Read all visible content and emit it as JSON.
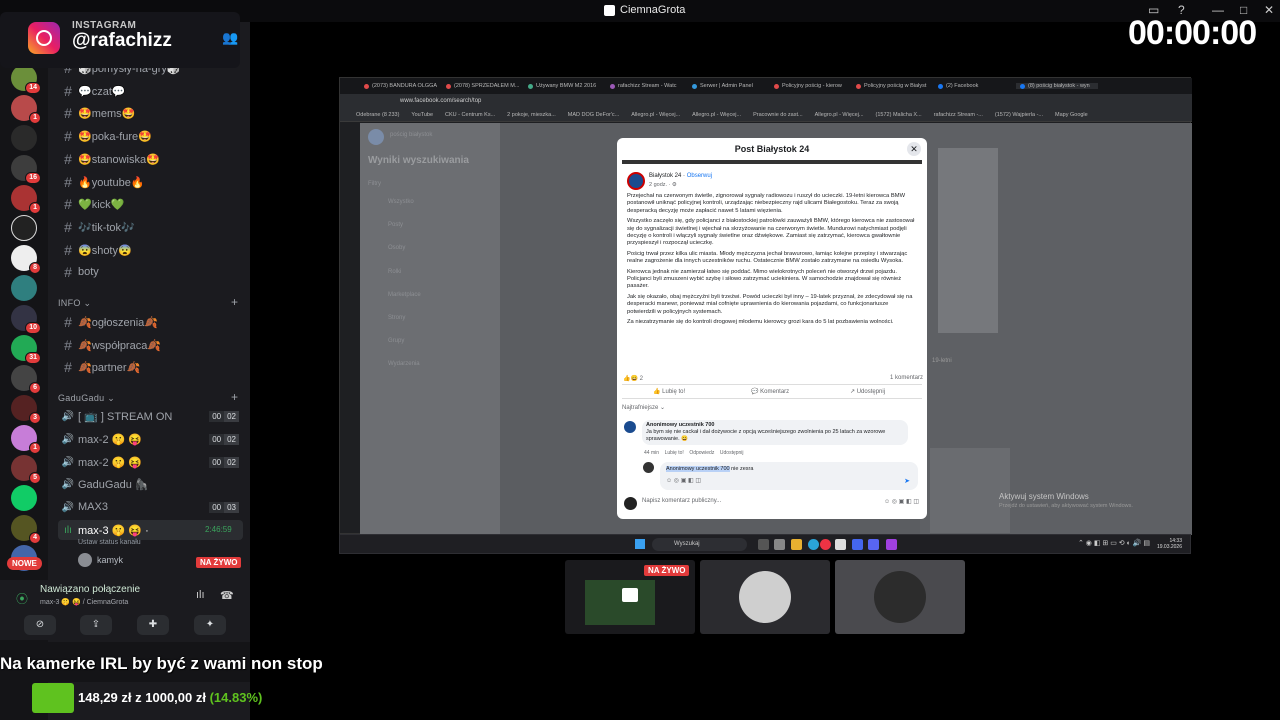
{
  "window": {
    "title": "CiemnaGrota"
  },
  "instagram": {
    "label": "INSTAGRAM",
    "handle": "@rafachizz"
  },
  "stream_timer": "00:00:00",
  "server_badges": [
    "14",
    "1",
    "16",
    "1",
    "8",
    "10",
    "31",
    "6",
    "3",
    "1",
    "5",
    "4"
  ],
  "channels": [
    {
      "label": "🎲pomysły-na-gry🎲"
    },
    {
      "label": "💬czat💬"
    },
    {
      "label": "🤩mems🤩"
    },
    {
      "label": "🤩poka-fure🤩"
    },
    {
      "label": "🤩stanowiska🤩"
    },
    {
      "label": "🔥youtube🔥"
    },
    {
      "label": "💚kick💚"
    },
    {
      "label": "🎶tik-tok🎶"
    },
    {
      "label": "😨shoty😨"
    },
    {
      "label": "boty"
    }
  ],
  "info_category": "INFO",
  "info_channels": [
    {
      "label": "🍂ogłoszenia🍂"
    },
    {
      "label": "🍂współpraca🍂"
    },
    {
      "label": "🍂partner🍂"
    }
  ],
  "voice_category": "GaduGadu",
  "voice_channels": [
    {
      "label": "[ 📺 ] STREAM ON",
      "count": "00",
      "limit": "02"
    },
    {
      "label": "max-2 🤫 😝",
      "count": "00",
      "limit": "02"
    },
    {
      "label": "max-2 🤫 😝",
      "count": "00",
      "limit": "02"
    },
    {
      "label": "GaduGadu 🦍",
      "count": "",
      "limit": ""
    },
    {
      "label": "MAX3",
      "count": "00",
      "limit": "03"
    },
    {
      "label": "max-3 🤫 😝 ·",
      "count": "",
      "limit": ""
    }
  ],
  "active_voice": {
    "timer": "2:46:59",
    "status_hint": "Ustaw status kanału",
    "user": "kamyk",
    "live_badge": "NA ŻYWO",
    "new_badge": "NOWE"
  },
  "voice_panel": {
    "title": "Nawiązano połączenie",
    "subtitle": "max-3 🤫 😝 / CiemnaGrota"
  },
  "browser": {
    "tabs": [
      "(2073) BANDURA OLGGA",
      "(2078) SPRZEDAŁEM M...",
      "Używany BMW M2 2016",
      "rafachizz Stream - Watc",
      "Serwer | Admin Panel",
      "Policyjny pościg - kierow",
      "Policyjny pościg w Białyst",
      "(2) Facebook",
      "(8) pościg białystok - wyn"
    ],
    "address": "www.facebook.com/search/top",
    "bookmarks": [
      "Odebrane (8 233)",
      "YouTube",
      "CKU - Centrum Ks...",
      "2 pokoje, mieszka...",
      "MAD DOG DeFor'c...",
      "Allegro.pl - Więcej...",
      "Allegro.pl - Więcej...",
      "Pracownie do zast...",
      "Allegro.pl - Więcej...",
      "(1572) Malicha X...",
      "rafachizz Stream -...",
      "(1572) Wajpierla -...",
      "Mapy Google"
    ]
  },
  "facebook": {
    "search_placeholder": "pościg białystok",
    "results_heading": "Wyniki wyszukiwania",
    "filters_label": "Filtry",
    "nav": [
      "Wszystko",
      "Posty",
      "Osoby",
      "Rolki",
      "Marketplace",
      "Strony",
      "Grupy",
      "Wydarzenia"
    ]
  },
  "post": {
    "modal_title": "Post Białystok 24",
    "author": "Białystok 24",
    "follow": "Obserwuj",
    "time": "2 godz.",
    "paragraphs": [
      "Przejechał na czerwonym świetle, zignorował sygnały radiowozu i ruszył do ucieczki. 19-letni kierowca BMW postanowił uniknąć policyjnej kontroli, urządzając niebezpieczny rajd ulicami Białegostoku. Teraz za swoją desperacką decyzję może zapłacić nawet 5 latami więzienia.",
      "Wszystko zaczęło się, gdy policjanci z białostockiej patrolówki zauważyli BMW, którego kierowca nie zastosował się do sygnalizacji świetlnej i wjechał na skrzyżowanie na czerwonym świetle. Mundurowi natychmiast podjęli decyzję o kontroli i włączyli sygnały świetlne oraz dźwiękowe. Zamiast się zatrzymać, kierowca gwałtownie przyspieszył i rozpoczął ucieczkę.",
      "Pościg trwał przez kilka ulic miasta. Młody mężczyzna jechał brawurowo, łamiąc kolejne przepisy i stwarzając realne zagrożenie dla innych uczestników ruchu. Ostatecznie BMW zostało zatrzymane na osiedlu Wysoka.",
      "Kierowca jednak nie zamierzał łatwo się poddać. Mimo wielokrotnych poleceń nie otworzył drzwi pojazdu. Policjanci byli zmuszeni wybić szybę i siłowo zatrzymać uciekiniera. W samochodzie znajdował się również pasażer.",
      "Jak się okazało, obaj mężczyźni byli trzeźwi. Powód ucieczki był inny – 19-latek przyznał, że zdecydował się na desperacki manewr, ponieważ miał cofnięte uprawnienia do kierowania pojazdami, co funkcjonariusze potwierdzili w policyjnych systemach.",
      "Za niezatrzymanie się do kontroli drogowej młodemu kierowcy grozi kara do 5 lat pozbawienia wolności."
    ],
    "reactions_count": "2",
    "comments_count": "1 komentarz",
    "like": "Lubię to!",
    "comment": "Komentarz",
    "share": "Udostępnij",
    "sort": "Najtrafniejsze",
    "comment_author": "Anonimowy uczestnik 700",
    "comment_text": "Ja bym się nie cackał i dał dożywocie z opcją wcześniejszego zwolnienia po 25 latach za wzorowe sprawowanie. 😄",
    "comment_meta": [
      "44 min",
      "Lubię to!",
      "Odpowiedz",
      "Udostępnij"
    ],
    "reply_mention": "Anonimowy uczestnik 700",
    "reply_text": " nie zesra",
    "input_placeholder": "Napisz komentarz publiczny..."
  },
  "side_results": {
    "snippet1": "19-letni",
    "snippet2": "Aktywuj system Windows",
    "snippet3": "Przejdź do ustawień, aby aktywować system Windows."
  },
  "taskbar": {
    "search": "Wyszukaj",
    "time": "14:33",
    "date": "19.03.2026"
  },
  "preview_badge": "NA ŻYWO",
  "banner": "Na kamerke IRL by być z wami non stop",
  "goal": {
    "current": "148,29 zł",
    "sep": "z",
    "target": "1000,00 zł",
    "pct": "(14.83%)",
    "fraction": 0.1483
  },
  "colors": {
    "accent_red": "#e23b3b",
    "goal_green": "#5fc21f",
    "discord_bg": "#1b1b1f",
    "fb_blue": "#1877f2"
  }
}
